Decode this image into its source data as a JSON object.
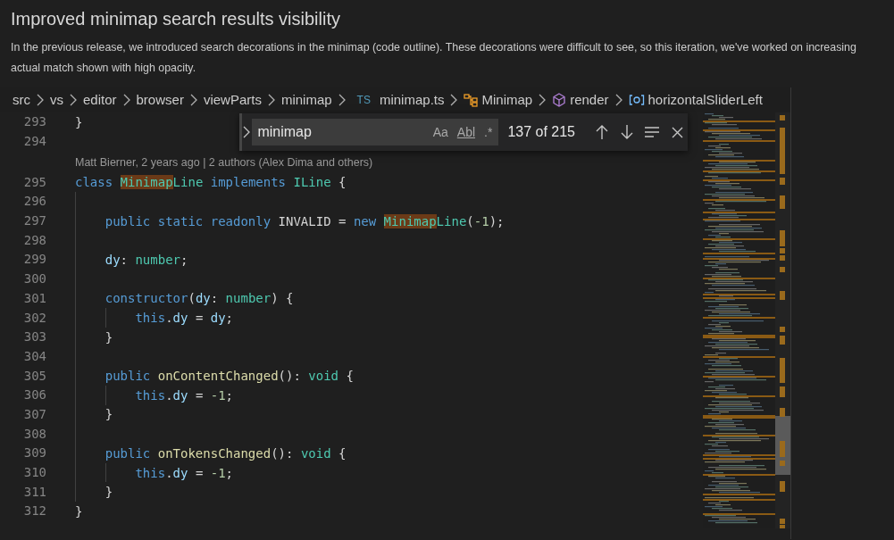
{
  "heading": "Improved minimap search results visibility",
  "description": [
    "In the previous release, we introduced search decorations in the minimap (code outline). These decorations were difficult to see, so this iteration, we've worked on increasing",
    "actual match shown with high opacity."
  ],
  "breadcrumbs": [
    {
      "kind": "folder",
      "label": "src"
    },
    {
      "kind": "folder",
      "label": "vs"
    },
    {
      "kind": "folder",
      "label": "editor"
    },
    {
      "kind": "folder",
      "label": "browser"
    },
    {
      "kind": "folder",
      "label": "viewParts"
    },
    {
      "kind": "folder",
      "label": "minimap"
    },
    {
      "kind": "file",
      "badge": "TS",
      "label": "minimap.ts"
    },
    {
      "kind": "class",
      "label": "Minimap"
    },
    {
      "kind": "method",
      "label": "render"
    },
    {
      "kind": "field",
      "label": "horizontalSliderLeft"
    }
  ],
  "find_widget": {
    "value": "minimap",
    "toggles": [
      {
        "label": "Aa",
        "selected": false
      },
      {
        "label": "Abl",
        "selected": false
      },
      {
        "label": ".*",
        "selected": false
      }
    ],
    "match_count": "137 of 215"
  },
  "code_lines": [
    {
      "kind": "code",
      "number": "293",
      "tokens": [
        {
          "kind": "plain",
          "text": "}"
        }
      ]
    },
    {
      "kind": "code",
      "number": "294"
    },
    {
      "kind": "codelens",
      "text": "Matt Bierner, 2 years ago | 2 authors (Alex Dima and others)"
    },
    {
      "kind": "code",
      "number": "295",
      "tokens": [
        {
          "kind": "keyword",
          "text": "class "
        },
        {
          "kind": "match",
          "text": "Minimap"
        },
        {
          "kind": "type",
          "text": "Line"
        },
        {
          "kind": "keyword",
          "text": " implements "
        },
        {
          "kind": "type",
          "text": "ILine"
        },
        {
          "kind": "plain",
          "text": " {"
        }
      ]
    },
    {
      "kind": "code",
      "number": "296"
    },
    {
      "kind": "code",
      "number": "297",
      "tokens": [
        {
          "kind": "keyword",
          "text": "    public static readonly "
        },
        {
          "kind": "plain",
          "text": "INVALID = "
        },
        {
          "kind": "keyword",
          "text": "new "
        },
        {
          "kind": "match",
          "text": "Minimap"
        },
        {
          "kind": "type",
          "text": "Line"
        },
        {
          "kind": "plain",
          "text": "("
        },
        {
          "kind": "number",
          "text": "-1"
        },
        {
          "kind": "plain",
          "text": ");"
        }
      ]
    },
    {
      "kind": "code",
      "number": "298"
    },
    {
      "kind": "code",
      "number": "299",
      "tokens": [
        {
          "kind": "variable",
          "text": "    dy"
        },
        {
          "kind": "plain",
          "text": ": "
        },
        {
          "kind": "type",
          "text": "number"
        },
        {
          "kind": "plain",
          "text": ";"
        }
      ]
    },
    {
      "kind": "code",
      "number": "300"
    },
    {
      "kind": "code",
      "number": "301",
      "tokens": [
        {
          "kind": "keyword",
          "text": "    constructor"
        },
        {
          "kind": "plain",
          "text": "("
        },
        {
          "kind": "variable",
          "text": "dy"
        },
        {
          "kind": "plain",
          "text": ": "
        },
        {
          "kind": "type",
          "text": "number"
        },
        {
          "kind": "plain",
          "text": ") {"
        }
      ]
    },
    {
      "kind": "code",
      "number": "302",
      "tokens": [
        {
          "kind": "keyword",
          "text": "        this"
        },
        {
          "kind": "plain",
          "text": "."
        },
        {
          "kind": "variable",
          "text": "dy"
        },
        {
          "kind": "plain",
          "text": " = "
        },
        {
          "kind": "variable",
          "text": "dy"
        },
        {
          "kind": "plain",
          "text": ";"
        }
      ]
    },
    {
      "kind": "code",
      "number": "303",
      "tokens": [
        {
          "kind": "plain",
          "text": "    }"
        }
      ]
    },
    {
      "kind": "code",
      "number": "304"
    },
    {
      "kind": "code",
      "number": "305",
      "tokens": [
        {
          "kind": "keyword",
          "text": "    public "
        },
        {
          "kind": "function",
          "text": "onContentChanged"
        },
        {
          "kind": "plain",
          "text": "(): "
        },
        {
          "kind": "type",
          "text": "void"
        },
        {
          "kind": "plain",
          "text": " {"
        }
      ]
    },
    {
      "kind": "code",
      "number": "306",
      "tokens": [
        {
          "kind": "keyword",
          "text": "        this"
        },
        {
          "kind": "plain",
          "text": "."
        },
        {
          "kind": "variable",
          "text": "dy"
        },
        {
          "kind": "plain",
          "text": " = "
        },
        {
          "kind": "number",
          "text": "-1"
        },
        {
          "kind": "plain",
          "text": ";"
        }
      ]
    },
    {
      "kind": "code",
      "number": "307",
      "tokens": [
        {
          "kind": "plain",
          "text": "    }"
        }
      ]
    },
    {
      "kind": "code",
      "number": "308"
    },
    {
      "kind": "code",
      "number": "309",
      "tokens": [
        {
          "kind": "keyword",
          "text": "    public "
        },
        {
          "kind": "function",
          "text": "onTokensChanged"
        },
        {
          "kind": "plain",
          "text": "(): "
        },
        {
          "kind": "type",
          "text": "void"
        },
        {
          "kind": "plain",
          "text": " {"
        }
      ]
    },
    {
      "kind": "code",
      "number": "310",
      "tokens": [
        {
          "kind": "keyword",
          "text": "        this"
        },
        {
          "kind": "plain",
          "text": "."
        },
        {
          "kind": "variable",
          "text": "dy"
        },
        {
          "kind": "plain",
          "text": " = "
        },
        {
          "kind": "number",
          "text": "-1"
        },
        {
          "kind": "plain",
          "text": ";"
        }
      ]
    },
    {
      "kind": "code",
      "number": "311",
      "tokens": [
        {
          "kind": "plain",
          "text": "    }"
        }
      ]
    },
    {
      "kind": "code",
      "number": "312",
      "tokens": [
        {
          "kind": "plain",
          "text": "}"
        }
      ]
    }
  ]
}
